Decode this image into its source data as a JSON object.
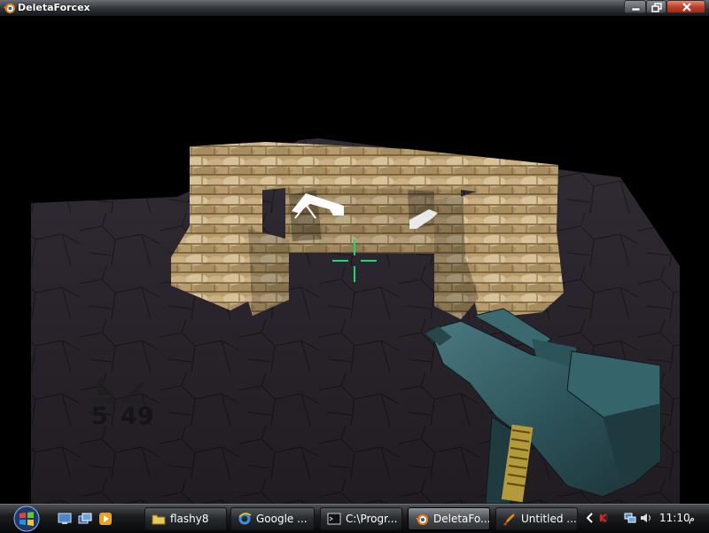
{
  "window": {
    "title": "DeletaForcex"
  },
  "hud": {
    "rounds": {
      "label": "rounds",
      "value": "5"
    },
    "ammo": {
      "label": "ammo",
      "value": "49"
    }
  },
  "taskbar": {
    "tasks": [
      {
        "label": "flashy8",
        "icon": "folder-icon"
      },
      {
        "label": "Google ...",
        "icon": "internet-explorer-icon"
      },
      {
        "label": "C:\\Progr...",
        "icon": "console-icon"
      },
      {
        "label": "DeletaFo...",
        "icon": "blender-icon",
        "active": true
      },
      {
        "label": "Untitled ...",
        "icon": "paint-icon"
      }
    ],
    "clock": {
      "time": "11:10",
      "suffix": "م"
    }
  },
  "colors": {
    "crosshair": "#19d86e",
    "ground": "#3d3640",
    "sky": "#000000"
  }
}
